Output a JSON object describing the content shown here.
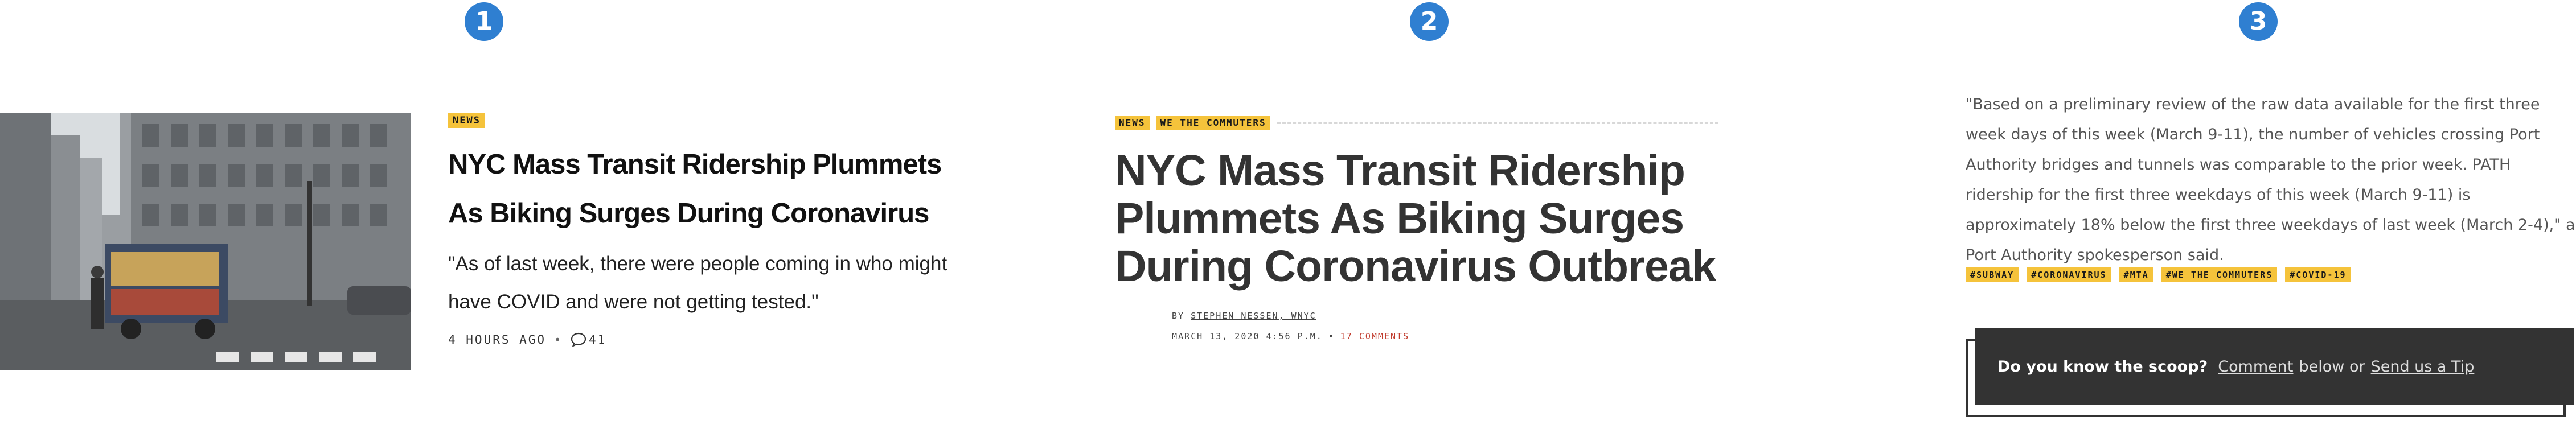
{
  "steps": [
    "1",
    "2",
    "3"
  ],
  "card1": {
    "tag": "NEWS",
    "headline": "NYC Mass Transit Ridership Plummets As Biking Surges During Coronavirus",
    "quote": "\"As of last week, there were people coming in who might have COVID and were not getting tested.\"",
    "time": "4 HOURS AGO",
    "comments_count": "41"
  },
  "article": {
    "tags": [
      "NEWS",
      "WE THE COMMUTERS"
    ],
    "headline": "NYC Mass Transit Ridership Plummets As Biking Surges During Coronavirus Outbreak",
    "byline_prefix": "BY",
    "author": "STEPHEN NESSEN, WNYC",
    "date": "MARCH 13, 2020 4:56 P.M.",
    "comments_link": "17 COMMENTS"
  },
  "body": {
    "quote": "\"Based on a preliminary review of the raw data available for the first three week days of this week (March 9-11), the number of vehicles crossing Port Authority bridges and tunnels was comparable to the prior week. PATH ridership for the first three weekdays of this week (March 9-11) is approximately 18% below the first three weekdays of last week (March 2-4),\" a Port Authority spokesperson said.",
    "tags": [
      "#SUBWAY",
      "#CORONAVIRUS",
      "#MTA",
      "#WE THE COMMUTERS",
      "#COVID-19"
    ],
    "scoop": {
      "lead": "Do you know the scoop?",
      "comment_link": "Comment",
      "middle": "below or",
      "tip_link": "Send us a Tip"
    }
  },
  "colors": {
    "tag": "#f5c33b",
    "badge": "#2f7fd1",
    "scoop_bg": "#333333",
    "comment_link": "#c0392b"
  },
  "icons": {
    "comment": "speech-bubble-icon"
  }
}
